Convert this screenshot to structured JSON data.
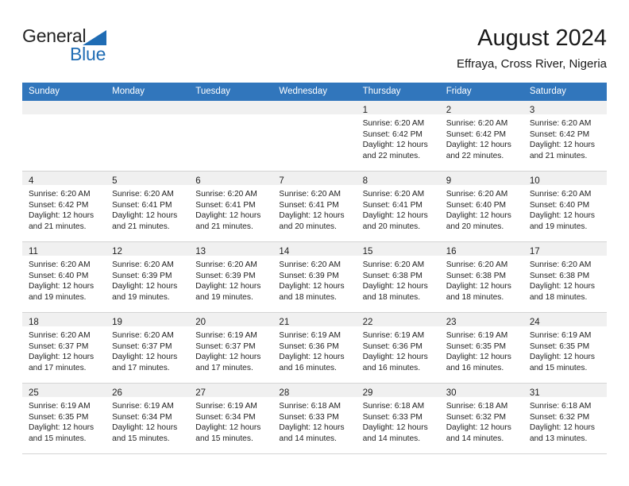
{
  "brand": {
    "name_part1": "General",
    "name_part2": "Blue",
    "triangle_icon": "triangle-icon",
    "accent_color": "#1f6cb4"
  },
  "header": {
    "title": "August 2024",
    "subtitle": "Effraya, Cross River, Nigeria"
  },
  "theme": {
    "header_blue": "#3176bc",
    "daynum_band": "#f0f0f0",
    "grid_line": "#d4d4d4"
  },
  "weekdays": [
    "Sunday",
    "Monday",
    "Tuesday",
    "Wednesday",
    "Thursday",
    "Friday",
    "Saturday"
  ],
  "weeks": [
    [
      {
        "day": "",
        "empty": true,
        "l1": "",
        "l2": "",
        "l3": "",
        "l4": ""
      },
      {
        "day": "",
        "empty": true,
        "l1": "",
        "l2": "",
        "l3": "",
        "l4": ""
      },
      {
        "day": "",
        "empty": true,
        "l1": "",
        "l2": "",
        "l3": "",
        "l4": ""
      },
      {
        "day": "",
        "empty": true,
        "l1": "",
        "l2": "",
        "l3": "",
        "l4": ""
      },
      {
        "day": "1",
        "empty": false,
        "l1": "Sunrise: 6:20 AM",
        "l2": "Sunset: 6:42 PM",
        "l3": "Daylight: 12 hours",
        "l4": "and 22 minutes."
      },
      {
        "day": "2",
        "empty": false,
        "l1": "Sunrise: 6:20 AM",
        "l2": "Sunset: 6:42 PM",
        "l3": "Daylight: 12 hours",
        "l4": "and 22 minutes."
      },
      {
        "day": "3",
        "empty": false,
        "l1": "Sunrise: 6:20 AM",
        "l2": "Sunset: 6:42 PM",
        "l3": "Daylight: 12 hours",
        "l4": "and 21 minutes."
      }
    ],
    [
      {
        "day": "4",
        "empty": false,
        "l1": "Sunrise: 6:20 AM",
        "l2": "Sunset: 6:42 PM",
        "l3": "Daylight: 12 hours",
        "l4": "and 21 minutes."
      },
      {
        "day": "5",
        "empty": false,
        "l1": "Sunrise: 6:20 AM",
        "l2": "Sunset: 6:41 PM",
        "l3": "Daylight: 12 hours",
        "l4": "and 21 minutes."
      },
      {
        "day": "6",
        "empty": false,
        "l1": "Sunrise: 6:20 AM",
        "l2": "Sunset: 6:41 PM",
        "l3": "Daylight: 12 hours",
        "l4": "and 21 minutes."
      },
      {
        "day": "7",
        "empty": false,
        "l1": "Sunrise: 6:20 AM",
        "l2": "Sunset: 6:41 PM",
        "l3": "Daylight: 12 hours",
        "l4": "and 20 minutes."
      },
      {
        "day": "8",
        "empty": false,
        "l1": "Sunrise: 6:20 AM",
        "l2": "Sunset: 6:41 PM",
        "l3": "Daylight: 12 hours",
        "l4": "and 20 minutes."
      },
      {
        "day": "9",
        "empty": false,
        "l1": "Sunrise: 6:20 AM",
        "l2": "Sunset: 6:40 PM",
        "l3": "Daylight: 12 hours",
        "l4": "and 20 minutes."
      },
      {
        "day": "10",
        "empty": false,
        "l1": "Sunrise: 6:20 AM",
        "l2": "Sunset: 6:40 PM",
        "l3": "Daylight: 12 hours",
        "l4": "and 19 minutes."
      }
    ],
    [
      {
        "day": "11",
        "empty": false,
        "l1": "Sunrise: 6:20 AM",
        "l2": "Sunset: 6:40 PM",
        "l3": "Daylight: 12 hours",
        "l4": "and 19 minutes."
      },
      {
        "day": "12",
        "empty": false,
        "l1": "Sunrise: 6:20 AM",
        "l2": "Sunset: 6:39 PM",
        "l3": "Daylight: 12 hours",
        "l4": "and 19 minutes."
      },
      {
        "day": "13",
        "empty": false,
        "l1": "Sunrise: 6:20 AM",
        "l2": "Sunset: 6:39 PM",
        "l3": "Daylight: 12 hours",
        "l4": "and 19 minutes."
      },
      {
        "day": "14",
        "empty": false,
        "l1": "Sunrise: 6:20 AM",
        "l2": "Sunset: 6:39 PM",
        "l3": "Daylight: 12 hours",
        "l4": "and 18 minutes."
      },
      {
        "day": "15",
        "empty": false,
        "l1": "Sunrise: 6:20 AM",
        "l2": "Sunset: 6:38 PM",
        "l3": "Daylight: 12 hours",
        "l4": "and 18 minutes."
      },
      {
        "day": "16",
        "empty": false,
        "l1": "Sunrise: 6:20 AM",
        "l2": "Sunset: 6:38 PM",
        "l3": "Daylight: 12 hours",
        "l4": "and 18 minutes."
      },
      {
        "day": "17",
        "empty": false,
        "l1": "Sunrise: 6:20 AM",
        "l2": "Sunset: 6:38 PM",
        "l3": "Daylight: 12 hours",
        "l4": "and 18 minutes."
      }
    ],
    [
      {
        "day": "18",
        "empty": false,
        "l1": "Sunrise: 6:20 AM",
        "l2": "Sunset: 6:37 PM",
        "l3": "Daylight: 12 hours",
        "l4": "and 17 minutes."
      },
      {
        "day": "19",
        "empty": false,
        "l1": "Sunrise: 6:20 AM",
        "l2": "Sunset: 6:37 PM",
        "l3": "Daylight: 12 hours",
        "l4": "and 17 minutes."
      },
      {
        "day": "20",
        "empty": false,
        "l1": "Sunrise: 6:19 AM",
        "l2": "Sunset: 6:37 PM",
        "l3": "Daylight: 12 hours",
        "l4": "and 17 minutes."
      },
      {
        "day": "21",
        "empty": false,
        "l1": "Sunrise: 6:19 AM",
        "l2": "Sunset: 6:36 PM",
        "l3": "Daylight: 12 hours",
        "l4": "and 16 minutes."
      },
      {
        "day": "22",
        "empty": false,
        "l1": "Sunrise: 6:19 AM",
        "l2": "Sunset: 6:36 PM",
        "l3": "Daylight: 12 hours",
        "l4": "and 16 minutes."
      },
      {
        "day": "23",
        "empty": false,
        "l1": "Sunrise: 6:19 AM",
        "l2": "Sunset: 6:35 PM",
        "l3": "Daylight: 12 hours",
        "l4": "and 16 minutes."
      },
      {
        "day": "24",
        "empty": false,
        "l1": "Sunrise: 6:19 AM",
        "l2": "Sunset: 6:35 PM",
        "l3": "Daylight: 12 hours",
        "l4": "and 15 minutes."
      }
    ],
    [
      {
        "day": "25",
        "empty": false,
        "l1": "Sunrise: 6:19 AM",
        "l2": "Sunset: 6:35 PM",
        "l3": "Daylight: 12 hours",
        "l4": "and 15 minutes."
      },
      {
        "day": "26",
        "empty": false,
        "l1": "Sunrise: 6:19 AM",
        "l2": "Sunset: 6:34 PM",
        "l3": "Daylight: 12 hours",
        "l4": "and 15 minutes."
      },
      {
        "day": "27",
        "empty": false,
        "l1": "Sunrise: 6:19 AM",
        "l2": "Sunset: 6:34 PM",
        "l3": "Daylight: 12 hours",
        "l4": "and 15 minutes."
      },
      {
        "day": "28",
        "empty": false,
        "l1": "Sunrise: 6:18 AM",
        "l2": "Sunset: 6:33 PM",
        "l3": "Daylight: 12 hours",
        "l4": "and 14 minutes."
      },
      {
        "day": "29",
        "empty": false,
        "l1": "Sunrise: 6:18 AM",
        "l2": "Sunset: 6:33 PM",
        "l3": "Daylight: 12 hours",
        "l4": "and 14 minutes."
      },
      {
        "day": "30",
        "empty": false,
        "l1": "Sunrise: 6:18 AM",
        "l2": "Sunset: 6:32 PM",
        "l3": "Daylight: 12 hours",
        "l4": "and 14 minutes."
      },
      {
        "day": "31",
        "empty": false,
        "l1": "Sunrise: 6:18 AM",
        "l2": "Sunset: 6:32 PM",
        "l3": "Daylight: 12 hours",
        "l4": "and 13 minutes."
      }
    ]
  ]
}
